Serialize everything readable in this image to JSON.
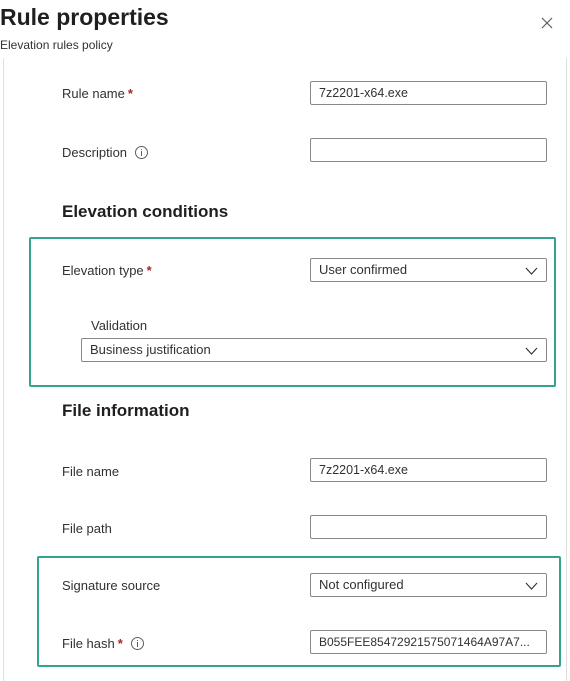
{
  "header": {
    "title": "Rule properties",
    "subtitle": "Elevation rules policy"
  },
  "icons": {
    "close": "close-icon",
    "info": "info-icon",
    "dropdown": "chevron-down-icon"
  },
  "colors": {
    "required": "#a4262c",
    "highlight": "#33a48c",
    "border": "#8a8886"
  },
  "fields": {
    "rule_name": {
      "label": "Rule name",
      "required": "*",
      "value": "7z2201-x64.exe"
    },
    "description": {
      "label": "Description",
      "value": ""
    }
  },
  "elevation": {
    "heading": "Elevation conditions",
    "type": {
      "label": "Elevation type",
      "required": "*",
      "value": "User confirmed"
    },
    "validation": {
      "label": "Validation",
      "value": "Business justification"
    }
  },
  "file_info": {
    "heading": "File information",
    "file_name": {
      "label": "File name",
      "value": "7z2201-x64.exe"
    },
    "file_path": {
      "label": "File path",
      "value": ""
    },
    "signature_source": {
      "label": "Signature source",
      "value": "Not configured"
    },
    "file_hash": {
      "label": "File hash",
      "required": "*",
      "value": "B055FEE85472921575071464A97A7..."
    }
  }
}
